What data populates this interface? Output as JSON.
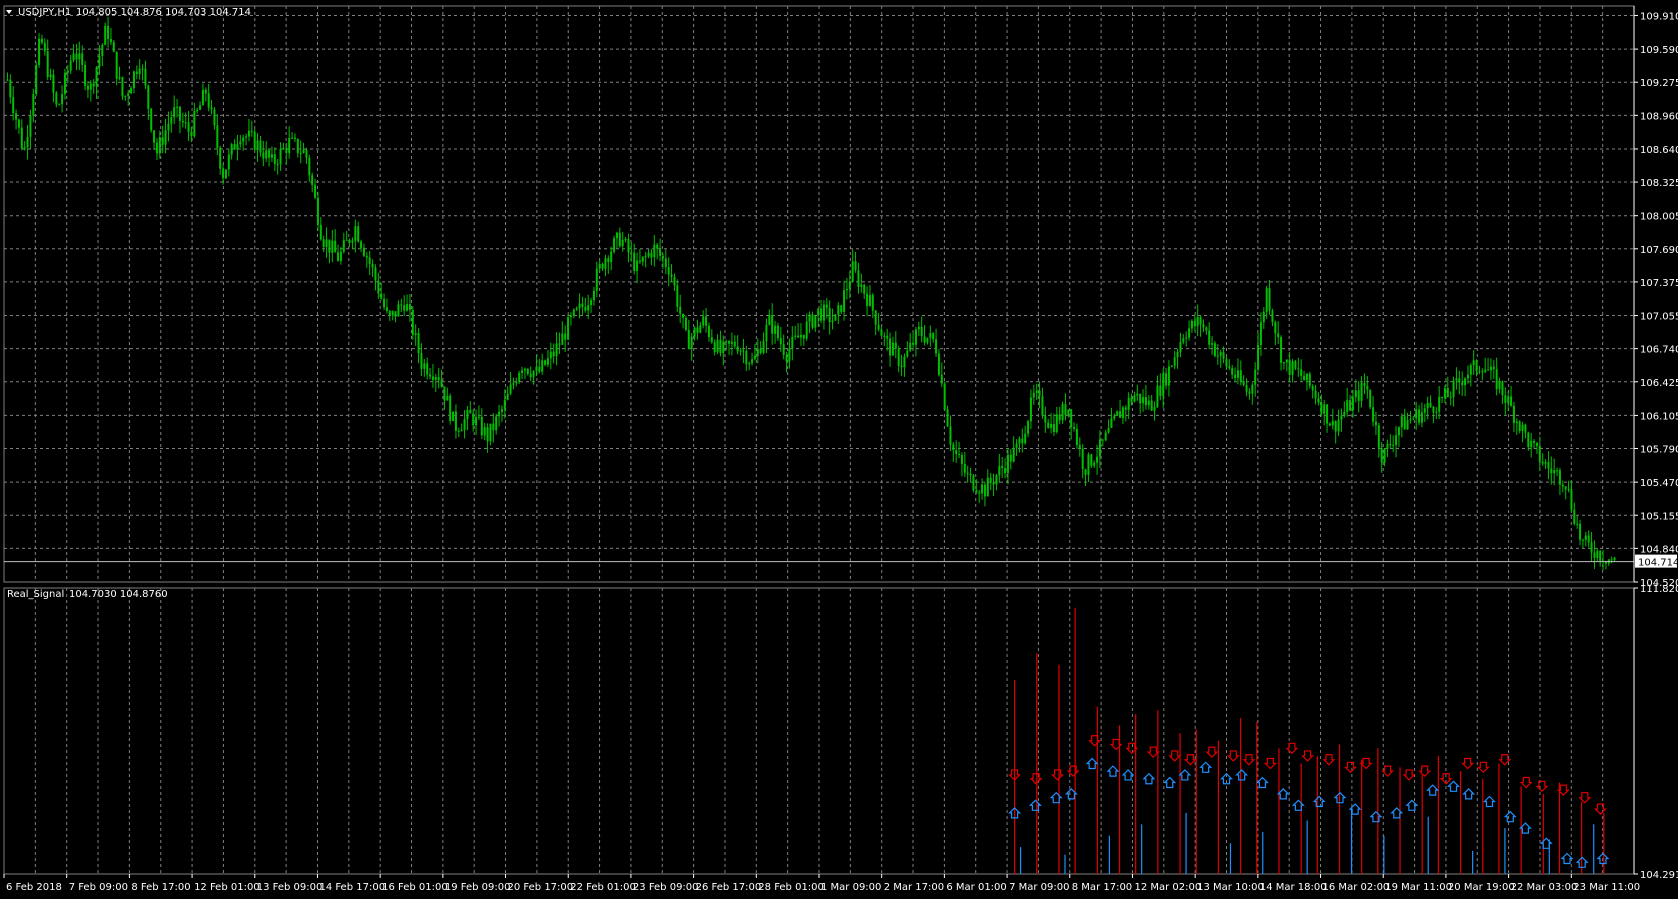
{
  "header": {
    "symbol_timeframe": "USDJPY,H1",
    "ohlc": "104.805 104.876 104.703 104.714",
    "indicator": "Real_Signal",
    "indicator_values": "104.7030 104.8760"
  },
  "colors": {
    "background": "#000000",
    "grid": "#7f7f7f",
    "candle": "#00c000",
    "text": "#ffffff",
    "signal_up": "#1e90ff",
    "signal_down": "#e00000"
  },
  "current_price_label": "104.714",
  "chart_data": [
    {
      "type": "candlestick",
      "x_axis": "time",
      "ylim": [
        104.52,
        110.0
      ],
      "y_ticks": [
        "109.910",
        "109.590",
        "109.275",
        "108.960",
        "108.640",
        "108.325",
        "108.005",
        "107.690",
        "107.375",
        "107.055",
        "106.740",
        "106.425",
        "106.105",
        "105.790",
        "105.470",
        "105.155",
        "104.840",
        "104.520"
      ],
      "current_price": 104.714,
      "price_path": [
        109.3,
        108.6,
        109.7,
        109.0,
        109.6,
        109.2,
        109.8,
        109.1,
        109.5,
        108.6,
        109.0,
        108.8,
        109.2,
        108.4,
        108.8,
        108.7,
        108.5,
        108.7,
        108.6,
        107.8,
        107.6,
        107.9,
        107.5,
        107.0,
        107.2,
        106.6,
        106.5,
        106.0,
        106.1,
        105.9,
        106.2,
        106.6,
        106.5,
        106.7,
        107.0,
        107.2,
        107.6,
        107.8,
        107.5,
        107.7,
        107.5,
        106.8,
        107.0,
        106.7,
        106.8,
        106.6,
        107.0,
        106.7,
        106.9,
        107.1,
        107.0,
        107.5,
        107.2,
        106.8,
        106.6,
        106.9,
        106.8,
        105.8,
        105.5,
        105.4,
        105.6,
        105.8,
        106.3,
        106.0,
        106.2,
        105.6,
        105.8,
        106.1,
        106.3,
        106.2,
        106.5,
        106.9,
        107.0,
        106.7,
        106.5,
        106.3,
        107.3,
        106.6,
        106.5,
        106.3,
        106.0,
        106.2,
        106.4,
        105.7,
        106.0,
        106.1,
        106.2,
        106.3,
        106.5,
        106.6,
        106.4,
        106.1,
        105.8,
        105.6,
        105.5,
        104.9,
        104.8,
        104.714
      ],
      "x_tick_labels": [
        "6 Feb 2018",
        "7 Feb 09:00",
        "8 Feb 17:00",
        "12 Feb 01:00",
        "13 Feb 09:00",
        "14 Feb 17:00",
        "16 Feb 01:00",
        "19 Feb 09:00",
        "20 Feb 17:00",
        "22 Feb 01:00",
        "23 Feb 09:00",
        "26 Feb 17:00",
        "28 Feb 01:00",
        "1 Mar 09:00",
        "2 Mar 17:00",
        "6 Mar 01:00",
        "7 Mar 09:00",
        "8 Mar 17:00",
        "12 Mar 02:00",
        "13 Mar 10:00",
        "14 Mar 18:00",
        "16 Mar 02:00",
        "19 Mar 11:00",
        "20 Mar 19:00",
        "22 Mar 03:00",
        "23 Mar 11:00"
      ]
    },
    {
      "type": "signal-histogram",
      "name": "Real_Signal",
      "ylim": [
        104.2918,
        111.8202
      ],
      "y_ticks": [
        "111.8202",
        "104.2918"
      ],
      "start_fraction": 0.62,
      "down_levels": [
        109.4,
        110.1,
        109.8,
        111.3,
        108.7,
        108.2,
        108.5,
        108.6,
        108.0,
        108.1,
        107.8,
        108.4,
        108.3,
        107.6,
        107.2,
        107.4,
        107.7,
        107.3,
        107.6,
        107.1,
        106.9,
        107.4,
        107.0,
        106.8,
        107.2,
        106.6,
        106.4,
        106.7,
        106.2,
        105.9
      ],
      "up_levels": [
        105.0,
        104.8,
        105.3,
        105.6,
        105.9,
        105.1,
        105.4,
        105.7,
        106.0,
        105.3,
        105.8,
        104.9,
        105.5,
        105.2,
        105.6
      ],
      "down_arrows": [
        106.9,
        106.8,
        106.9,
        107.0,
        107.8,
        107.7,
        107.6,
        107.5,
        107.4,
        107.3,
        107.5,
        107.4,
        107.3,
        107.2,
        107.6,
        107.4,
        107.3,
        107.1,
        107.2,
        107.0,
        106.9,
        107.0,
        106.8,
        107.2,
        107.1,
        107.3,
        106.7,
        106.6,
        106.5,
        106.3,
        106.0
      ],
      "up_arrows": [
        105.9,
        106.1,
        106.3,
        106.4,
        107.2,
        107.0,
        106.9,
        106.8,
        106.7,
        106.9,
        107.1,
        106.8,
        106.9,
        106.7,
        106.4,
        106.1,
        106.2,
        106.3,
        106.0,
        105.8,
        105.9,
        106.1,
        106.5,
        106.6,
        106.4,
        106.2,
        105.8,
        105.5,
        105.1,
        104.7,
        104.6,
        104.7
      ]
    }
  ]
}
